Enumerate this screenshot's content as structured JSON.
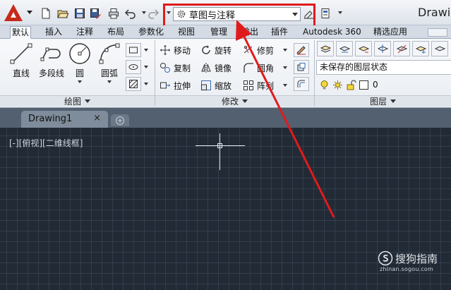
{
  "window": {
    "title": "Drawin",
    "workspace": {
      "value": "草图与注释"
    }
  },
  "ribbon_tabs": [
    "默认",
    "插入",
    "注释",
    "布局",
    "参数化",
    "视图",
    "管理",
    "输出",
    "插件",
    "Autodesk 360",
    "精选应用"
  ],
  "panels": {
    "draw": {
      "title": "绘图",
      "tools": [
        "直线",
        "多段线",
        "圆",
        "圆弧"
      ]
    },
    "modify": {
      "title": "修改",
      "tools": [
        "移动",
        "旋转",
        "修剪",
        "复制",
        "镜像",
        "圆角",
        "拉伸",
        "缩放",
        "阵列"
      ]
    },
    "layer": {
      "title": "图层",
      "state": "未保存的图层状态",
      "current_layer": "0"
    }
  },
  "file_tab": {
    "name": "Drawing1",
    "close": "×"
  },
  "viewport": {
    "label": "[-][俯视][二维线框]"
  },
  "watermark": {
    "brand": "搜狗指南",
    "url": "zhinan.sogou.com"
  },
  "colors": {
    "highlight": "#e01b1b",
    "canvas": "#222a35",
    "logo": "#c62a1b"
  }
}
